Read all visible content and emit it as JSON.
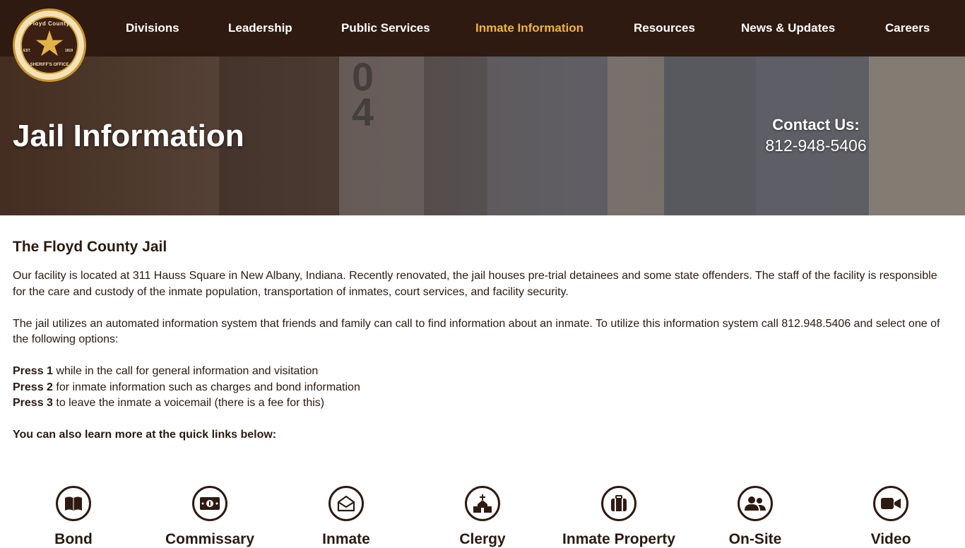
{
  "logo": {
    "top_text": "Floyd County",
    "bottom_text": "SHERIFF'S OFFICE",
    "est": "EST.",
    "year": "1819"
  },
  "nav": {
    "items": [
      {
        "label": "Divisions"
      },
      {
        "label": "Leadership"
      },
      {
        "label": "Public Services"
      },
      {
        "label": "Inmate Information",
        "active": true
      },
      {
        "label": "Resources"
      },
      {
        "label": "News & Updates"
      },
      {
        "label": "Careers"
      }
    ]
  },
  "hero": {
    "title": "Jail Information",
    "contact_label": "Contact Us:",
    "contact_phone": "812-948-5406"
  },
  "content": {
    "heading": "The Floyd County Jail",
    "para1": "Our facility is located at 311 Hauss Square in New Albany, Indiana. Recently renovated, the jail houses pre-trial detainees and some state offenders. The staff of the facility is responsible for the care and custody of the inmate population, transportation of inmates, court services, and facility security.",
    "para2": "The jail utilizes an automated information system that friends and family can call to find information about an inmate. To utilize this information system call 812.948.5406 and select one of the following options:",
    "options": [
      {
        "key": "Press 1",
        "text": " while in the call for general information and visitation"
      },
      {
        "key": "Press 2",
        "text": " for inmate information such as charges and bond information"
      },
      {
        "key": "Press 3",
        "text": " to leave the inmate a voicemail (there is a fee for this)"
      }
    ],
    "quick_links_intro": "You can also learn more at the quick links below:"
  },
  "quick_links": [
    {
      "label": "Bond",
      "icon": "book-icon"
    },
    {
      "label": "Commissary",
      "icon": "money-icon"
    },
    {
      "label": "Inmate",
      "icon": "envelope-icon"
    },
    {
      "label": "Clergy",
      "icon": "church-icon"
    },
    {
      "label": "Inmate Property",
      "icon": "suitcase-icon"
    },
    {
      "label": "On-Site",
      "icon": "users-icon"
    },
    {
      "label": "Video",
      "icon": "video-icon"
    }
  ],
  "colors": {
    "nav_bg": "#2f1a11",
    "active": "#f0b43a",
    "text": "#2b1a10"
  }
}
